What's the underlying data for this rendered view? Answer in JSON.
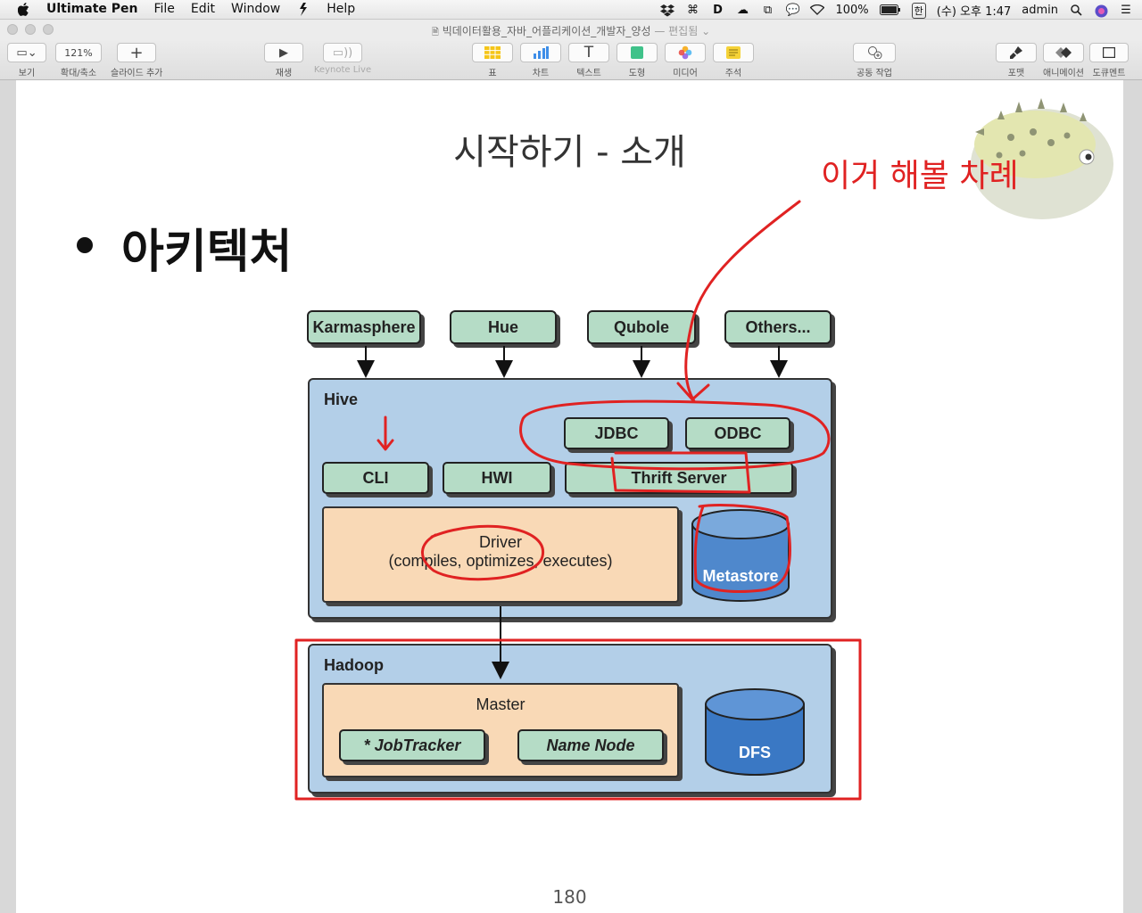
{
  "menubar": {
    "apple": "",
    "app_name": "Ultimate Pen",
    "menus": [
      "File",
      "Edit",
      "Window",
      "Help"
    ],
    "status": {
      "battery": "100%",
      "input_source": "한",
      "clock": "(수) 오후 1:47",
      "user": "admin"
    }
  },
  "window": {
    "title": "빅데이터활용_자바_어플리케이션_개발자_양성",
    "title_suffix": "— 편집됨"
  },
  "toolbar": {
    "view_label": "보기",
    "zoom_value": "121%",
    "zoom_label": "확대/축소",
    "add_slide_label": "슬라이드 추가",
    "play_label": "재생",
    "keynote_live_label": "Keynote Live",
    "table_label": "표",
    "chart_label": "차트",
    "text_label": "텍스트",
    "shape_label": "도형",
    "media_label": "미디어",
    "comment_label": "주석",
    "collaborate_label": "공동 작업",
    "format_label": "포맷",
    "animate_label": "애니메이션",
    "document_label": "도큐멘트"
  },
  "slide": {
    "title": "시작하기 - 소개",
    "bullet": "아키텍처",
    "page_number": "180",
    "annotation": "이거 해볼 차례"
  },
  "diagram": {
    "clients": [
      "Karmasphere",
      "Hue",
      "Qubole",
      "Others..."
    ],
    "hive": {
      "title": "Hive",
      "jdbc": "JDBC",
      "odbc": "ODBC",
      "cli": "CLI",
      "hwi": "HWI",
      "thrift": "Thrift Server",
      "driver": "Driver",
      "driver_desc": "(compiles, optimizes, executes)",
      "metastore": "Metastore"
    },
    "hadoop": {
      "title": "Hadoop",
      "master": "Master",
      "jobtracker": "* JobTracker",
      "namenode": "Name Node",
      "dfs": "DFS"
    }
  },
  "colors": {
    "annotation_red": "#e02222",
    "hive_panel": "#b3cfe8",
    "green_box": "#b5dcc6",
    "orange_box": "#f9d9b6",
    "cylinder_blue": "#3a78c4"
  }
}
